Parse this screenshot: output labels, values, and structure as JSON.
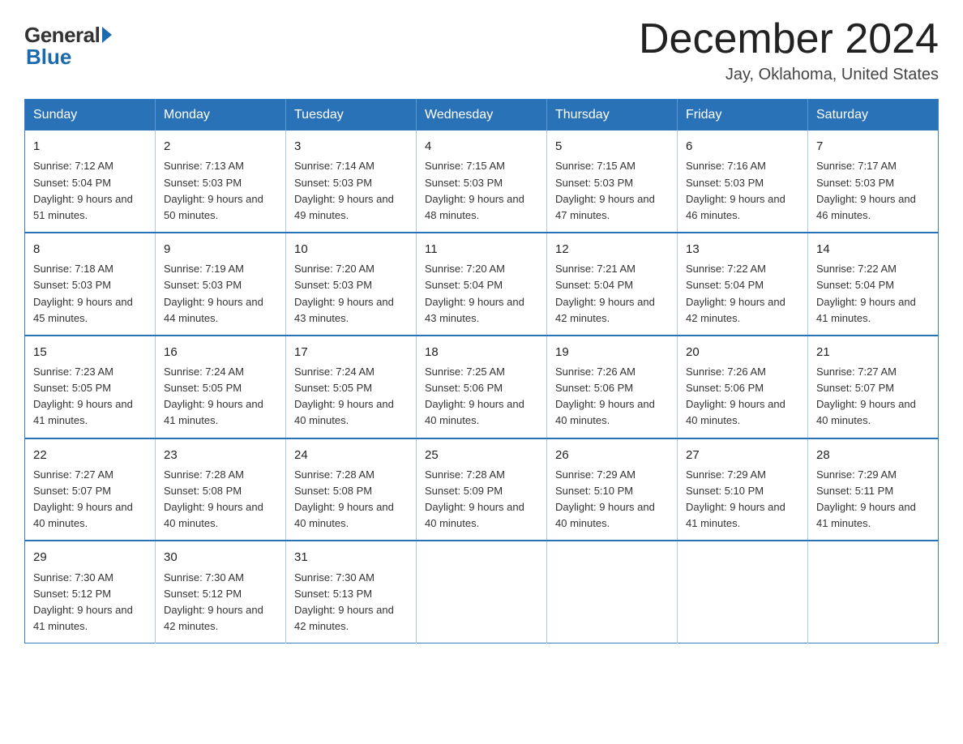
{
  "header": {
    "logo_general": "General",
    "logo_blue": "Blue",
    "month_title": "December 2024",
    "location": "Jay, Oklahoma, United States"
  },
  "calendar": {
    "days_of_week": [
      "Sunday",
      "Monday",
      "Tuesday",
      "Wednesday",
      "Thursday",
      "Friday",
      "Saturday"
    ],
    "weeks": [
      [
        {
          "day": "1",
          "sunrise": "Sunrise: 7:12 AM",
          "sunset": "Sunset: 5:04 PM",
          "daylight": "Daylight: 9 hours and 51 minutes."
        },
        {
          "day": "2",
          "sunrise": "Sunrise: 7:13 AM",
          "sunset": "Sunset: 5:03 PM",
          "daylight": "Daylight: 9 hours and 50 minutes."
        },
        {
          "day": "3",
          "sunrise": "Sunrise: 7:14 AM",
          "sunset": "Sunset: 5:03 PM",
          "daylight": "Daylight: 9 hours and 49 minutes."
        },
        {
          "day": "4",
          "sunrise": "Sunrise: 7:15 AM",
          "sunset": "Sunset: 5:03 PM",
          "daylight": "Daylight: 9 hours and 48 minutes."
        },
        {
          "day": "5",
          "sunrise": "Sunrise: 7:15 AM",
          "sunset": "Sunset: 5:03 PM",
          "daylight": "Daylight: 9 hours and 47 minutes."
        },
        {
          "day": "6",
          "sunrise": "Sunrise: 7:16 AM",
          "sunset": "Sunset: 5:03 PM",
          "daylight": "Daylight: 9 hours and 46 minutes."
        },
        {
          "day": "7",
          "sunrise": "Sunrise: 7:17 AM",
          "sunset": "Sunset: 5:03 PM",
          "daylight": "Daylight: 9 hours and 46 minutes."
        }
      ],
      [
        {
          "day": "8",
          "sunrise": "Sunrise: 7:18 AM",
          "sunset": "Sunset: 5:03 PM",
          "daylight": "Daylight: 9 hours and 45 minutes."
        },
        {
          "day": "9",
          "sunrise": "Sunrise: 7:19 AM",
          "sunset": "Sunset: 5:03 PM",
          "daylight": "Daylight: 9 hours and 44 minutes."
        },
        {
          "day": "10",
          "sunrise": "Sunrise: 7:20 AM",
          "sunset": "Sunset: 5:03 PM",
          "daylight": "Daylight: 9 hours and 43 minutes."
        },
        {
          "day": "11",
          "sunrise": "Sunrise: 7:20 AM",
          "sunset": "Sunset: 5:04 PM",
          "daylight": "Daylight: 9 hours and 43 minutes."
        },
        {
          "day": "12",
          "sunrise": "Sunrise: 7:21 AM",
          "sunset": "Sunset: 5:04 PM",
          "daylight": "Daylight: 9 hours and 42 minutes."
        },
        {
          "day": "13",
          "sunrise": "Sunrise: 7:22 AM",
          "sunset": "Sunset: 5:04 PM",
          "daylight": "Daylight: 9 hours and 42 minutes."
        },
        {
          "day": "14",
          "sunrise": "Sunrise: 7:22 AM",
          "sunset": "Sunset: 5:04 PM",
          "daylight": "Daylight: 9 hours and 41 minutes."
        }
      ],
      [
        {
          "day": "15",
          "sunrise": "Sunrise: 7:23 AM",
          "sunset": "Sunset: 5:05 PM",
          "daylight": "Daylight: 9 hours and 41 minutes."
        },
        {
          "day": "16",
          "sunrise": "Sunrise: 7:24 AM",
          "sunset": "Sunset: 5:05 PM",
          "daylight": "Daylight: 9 hours and 41 minutes."
        },
        {
          "day": "17",
          "sunrise": "Sunrise: 7:24 AM",
          "sunset": "Sunset: 5:05 PM",
          "daylight": "Daylight: 9 hours and 40 minutes."
        },
        {
          "day": "18",
          "sunrise": "Sunrise: 7:25 AM",
          "sunset": "Sunset: 5:06 PM",
          "daylight": "Daylight: 9 hours and 40 minutes."
        },
        {
          "day": "19",
          "sunrise": "Sunrise: 7:26 AM",
          "sunset": "Sunset: 5:06 PM",
          "daylight": "Daylight: 9 hours and 40 minutes."
        },
        {
          "day": "20",
          "sunrise": "Sunrise: 7:26 AM",
          "sunset": "Sunset: 5:06 PM",
          "daylight": "Daylight: 9 hours and 40 minutes."
        },
        {
          "day": "21",
          "sunrise": "Sunrise: 7:27 AM",
          "sunset": "Sunset: 5:07 PM",
          "daylight": "Daylight: 9 hours and 40 minutes."
        }
      ],
      [
        {
          "day": "22",
          "sunrise": "Sunrise: 7:27 AM",
          "sunset": "Sunset: 5:07 PM",
          "daylight": "Daylight: 9 hours and 40 minutes."
        },
        {
          "day": "23",
          "sunrise": "Sunrise: 7:28 AM",
          "sunset": "Sunset: 5:08 PM",
          "daylight": "Daylight: 9 hours and 40 minutes."
        },
        {
          "day": "24",
          "sunrise": "Sunrise: 7:28 AM",
          "sunset": "Sunset: 5:08 PM",
          "daylight": "Daylight: 9 hours and 40 minutes."
        },
        {
          "day": "25",
          "sunrise": "Sunrise: 7:28 AM",
          "sunset": "Sunset: 5:09 PM",
          "daylight": "Daylight: 9 hours and 40 minutes."
        },
        {
          "day": "26",
          "sunrise": "Sunrise: 7:29 AM",
          "sunset": "Sunset: 5:10 PM",
          "daylight": "Daylight: 9 hours and 40 minutes."
        },
        {
          "day": "27",
          "sunrise": "Sunrise: 7:29 AM",
          "sunset": "Sunset: 5:10 PM",
          "daylight": "Daylight: 9 hours and 41 minutes."
        },
        {
          "day": "28",
          "sunrise": "Sunrise: 7:29 AM",
          "sunset": "Sunset: 5:11 PM",
          "daylight": "Daylight: 9 hours and 41 minutes."
        }
      ],
      [
        {
          "day": "29",
          "sunrise": "Sunrise: 7:30 AM",
          "sunset": "Sunset: 5:12 PM",
          "daylight": "Daylight: 9 hours and 41 minutes."
        },
        {
          "day": "30",
          "sunrise": "Sunrise: 7:30 AM",
          "sunset": "Sunset: 5:12 PM",
          "daylight": "Daylight: 9 hours and 42 minutes."
        },
        {
          "day": "31",
          "sunrise": "Sunrise: 7:30 AM",
          "sunset": "Sunset: 5:13 PM",
          "daylight": "Daylight: 9 hours and 42 minutes."
        },
        null,
        null,
        null,
        null
      ]
    ]
  }
}
